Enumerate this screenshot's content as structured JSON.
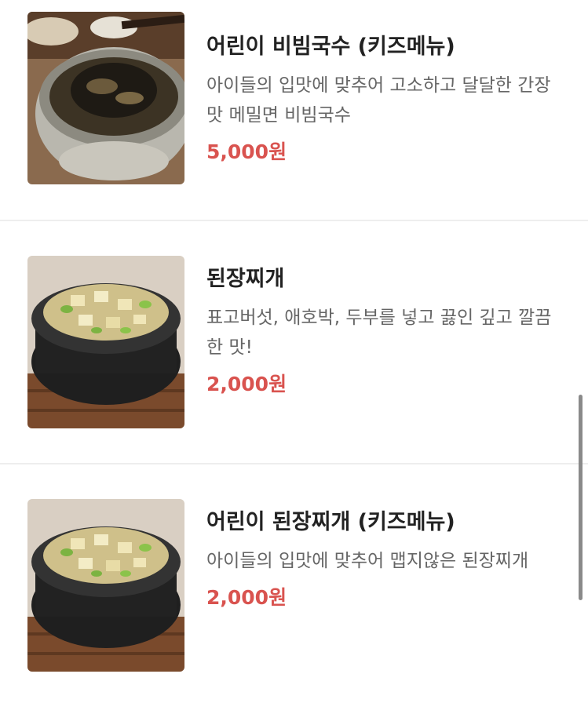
{
  "menu": {
    "items": [
      {
        "title": "어린이 비빔국수 (키즈메뉴)",
        "description": "아이들의 입맛에 맞추어 고소하고 달달한 간장맛 메밀면 비빔국수",
        "price": "5,000원",
        "image": "bibim-noodles-photo"
      },
      {
        "title": "된장찌개",
        "description": "표고버섯, 애호박, 두부를 넣고 끓인 깊고 깔끔한 맛!",
        "price": "2,000원",
        "image": "doenjang-stew-photo"
      },
      {
        "title": "어린이 된장찌개 (키즈메뉴)",
        "description": "아이들의 입맛에 맞추어 맵지않은 된장찌개",
        "price": "2,000원",
        "image": "doenjang-stew-photo"
      }
    ]
  },
  "colors": {
    "price": "#d9534f",
    "title": "#222222",
    "description": "#666666",
    "divider": "#eeeeee"
  }
}
